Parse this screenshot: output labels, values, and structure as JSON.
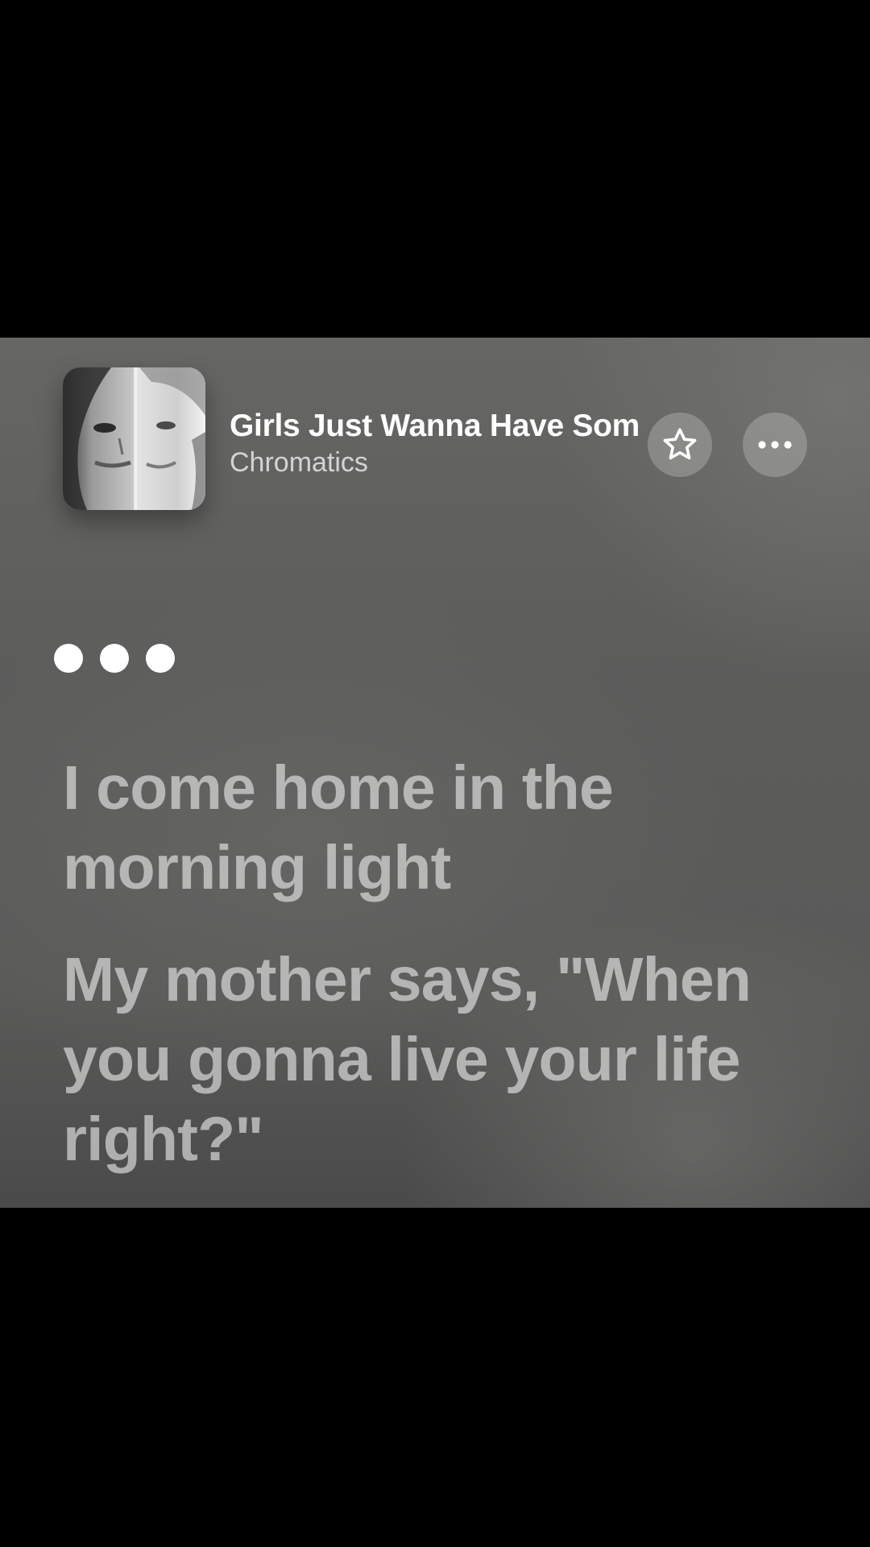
{
  "track": {
    "title": "Girls Just Wanna Have Some",
    "artist": "Chromatics"
  },
  "controls": {
    "favorite_icon": "star-outline-icon",
    "more_icon": "ellipsis-icon"
  },
  "lyrics": {
    "lines": [
      "I come home in the morning light",
      "My mother says, \"When you gonna live your life right?\""
    ]
  },
  "colors": {
    "background": "#5c5c5b",
    "lyric_text": "#ebebeb",
    "title_text": "#ffffff"
  }
}
